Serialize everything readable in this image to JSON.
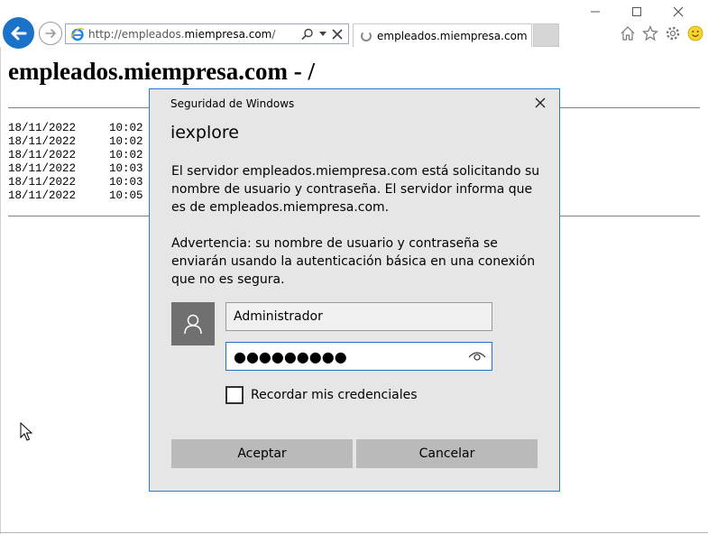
{
  "browser": {
    "url_prefix": "http://empleados.",
    "url_host": "miempresa.com",
    "url_suffix": "/",
    "tab_title": "empleados.miempresa.com",
    "window_controls": [
      "minimize-icon",
      "maximize-icon",
      "close-icon"
    ],
    "toolbar_icons": [
      "home-icon",
      "favorites-star-icon",
      "settings-gear-icon",
      "smiley-feedback-icon"
    ],
    "accent_color": "#1a73c8"
  },
  "page": {
    "title": "empleados.miempresa.com - /",
    "listing": [
      {
        "date": "18/11/2022",
        "time": "10:02"
      },
      {
        "date": "18/11/2022",
        "time": "10:02"
      },
      {
        "date": "18/11/2022",
        "time": "10:02"
      },
      {
        "date": "18/11/2022",
        "time": "10:03"
      },
      {
        "date": "18/11/2022",
        "time": "10:03"
      },
      {
        "date": "18/11/2022",
        "time": "10:05"
      }
    ]
  },
  "dialog": {
    "caption": "Seguridad de Windows",
    "heading": "iexplore",
    "message": "El servidor empleados.miempresa.com está solicitando su nombre de usuario y contraseña. El servidor informa que es de empleados.miempresa.com.",
    "warning": "Advertencia: su nombre de usuario y contraseña se enviarán usando la autenticación básica en una conexión que no es segura.",
    "username_value": "Administrador",
    "password_mask": "●●●●●●●●●",
    "remember_label": "Recordar mis credenciales",
    "remember_checked": false,
    "ok_label": "Aceptar",
    "cancel_label": "Cancelar"
  }
}
